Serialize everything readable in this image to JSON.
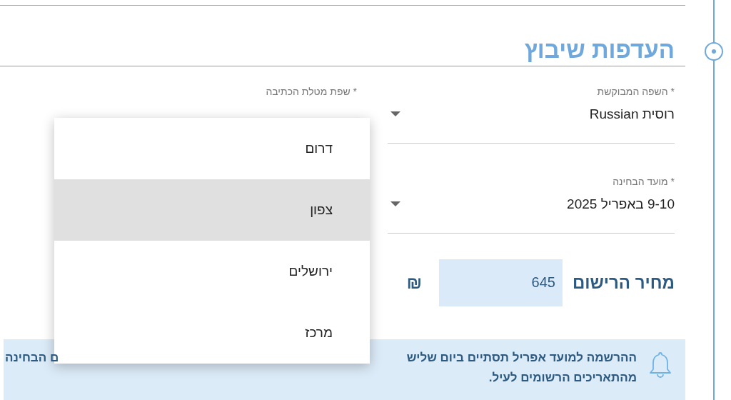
{
  "section": {
    "title": "העדפות שיבוץ"
  },
  "fields": [
    {
      "label": "* השפה המבוקשת",
      "value": "רוסית Russian"
    },
    {
      "label": "* מועד הבחינה",
      "value": "9-10 באפריל 2025"
    }
  ],
  "writing_language": {
    "label": "* שפת מטלת הכתיבה",
    "menu": {
      "options": [
        {
          "label": "דרום",
          "highlighted": false
        },
        {
          "label": "צפון",
          "highlighted": true
        },
        {
          "label": "ירושלים",
          "highlighted": false
        },
        {
          "label": "מרכז",
          "highlighted": false
        }
      ]
    }
  },
  "price": {
    "label": "מחיר הרישום",
    "value": "645",
    "currency": "₪"
  },
  "notice": {
    "line_1_start": "ההרשמה למועד אפריל תסתיים ביום שליש",
    "line_1_end": "ם הבחינה",
    "line_2": "מהתאריכים הרשומים לעיל."
  }
}
